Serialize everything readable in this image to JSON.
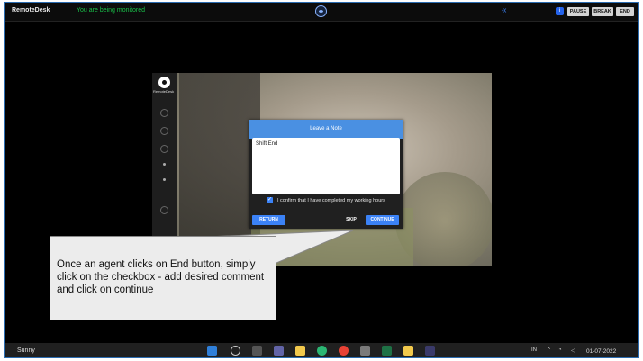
{
  "top_bar": {
    "app_name": "RemoteDesk",
    "monitor_status": "You are being monitored",
    "buttons": {
      "pause": "PAUSE",
      "break": "BREAK",
      "end": "END"
    },
    "info_icon": "i",
    "collapse_icon": "«"
  },
  "sidebar": {
    "brand": "RemoteDesk"
  },
  "dialog": {
    "title": "Leave a Note",
    "note_text": "Shift End",
    "checkbox_label": "I confirm that I have completed my working hours",
    "checkbox_checked": true,
    "buttons": {
      "return": "RETURN",
      "skip": "SKIP",
      "continue": "CONTINUE"
    }
  },
  "callout": {
    "text": "Once an agent clicks on End button, simply click on the checkbox - add desired comment and click on continue"
  },
  "taskbar": {
    "weather": "Sunny",
    "language": "IN",
    "date": "01-07-2022"
  },
  "colors": {
    "accent": "#4a90e2",
    "monitor_green": "#19c24a",
    "button_blue": "#3b82f6",
    "frame_border": "#2b6cb0"
  }
}
